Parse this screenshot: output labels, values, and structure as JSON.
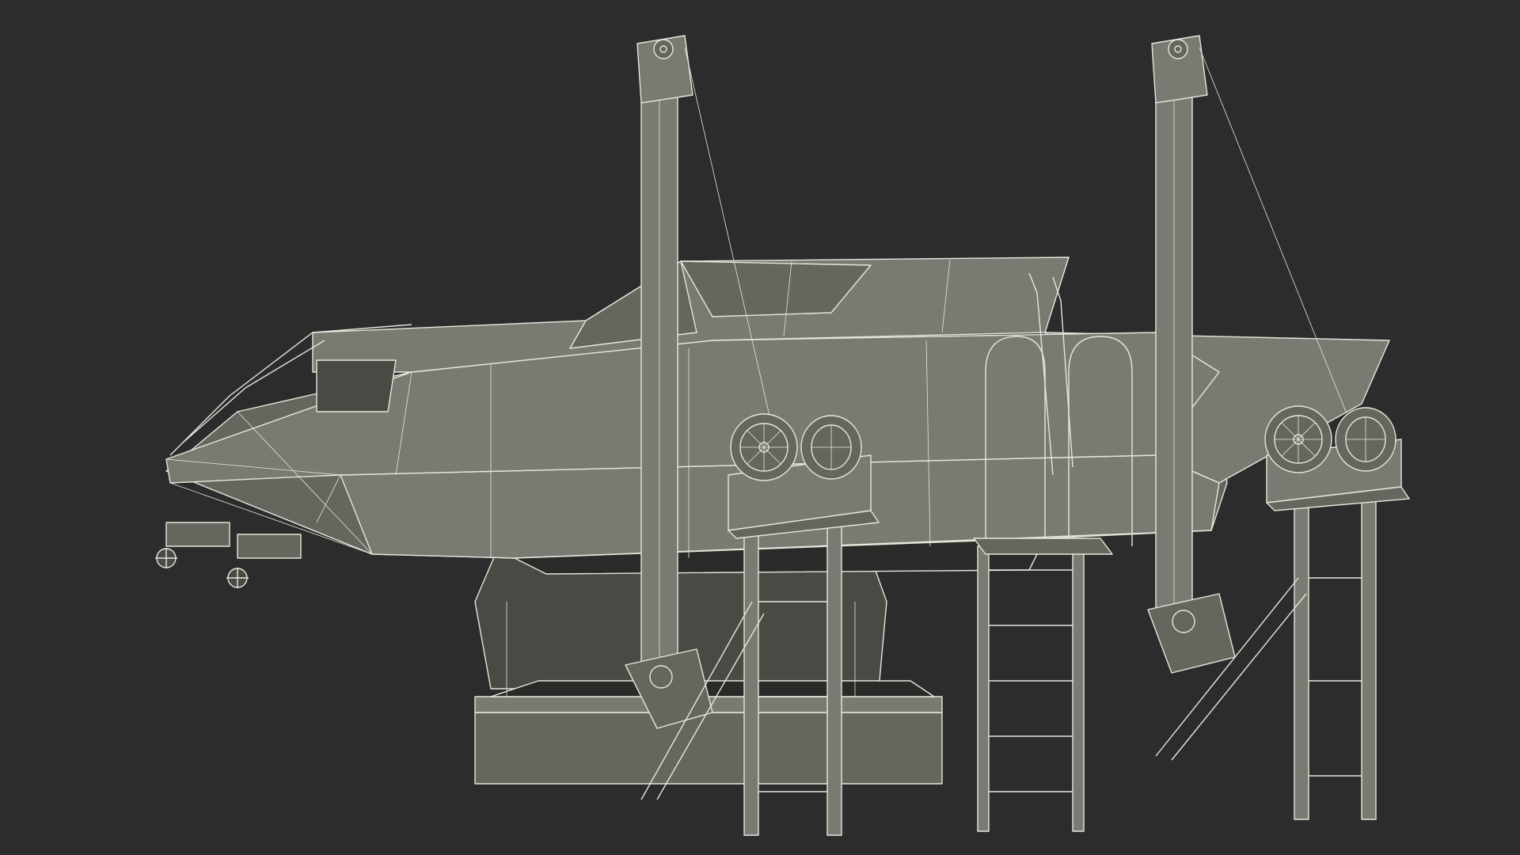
{
  "scene": {
    "subject": "boat-on-lift-wireframe-render",
    "background_color": "#2c2c2c",
    "model_fill_color": "#7a7a72",
    "model_shade_color": "#5e5e57",
    "model_dark_color": "#3a3a36",
    "wire_color": "#e6e6dc",
    "icons": [
      "winch-reel-icon",
      "crank-wheel-icon",
      "propeller-icon",
      "pulley-icon"
    ]
  }
}
